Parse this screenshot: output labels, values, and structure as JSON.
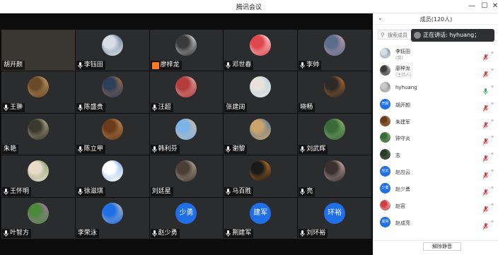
{
  "window": {
    "title": "腾讯会议",
    "min": "—",
    "max": "☐",
    "close": "✕"
  },
  "colors": {
    "host_badge": "#ff7a1a",
    "avatar_blue": "#1e6fe8",
    "mic_muted": "#d23c3c",
    "mic_active": "#32b45a"
  },
  "grid": [
    {
      "name": "胡开颜",
      "avatar": "none",
      "mic": "none",
      "highlight": true
    },
    {
      "name": "李钰田",
      "avatar": "photo",
      "colors": [
        "#4c6a86",
        "#d7dee6"
      ],
      "mic": "icon"
    },
    {
      "name": "廖梓龙",
      "avatar": "photo",
      "colors": [
        "#ffffff",
        "#3a3a3a"
      ],
      "mic": "badge"
    },
    {
      "name": "邓世春",
      "avatar": "photo",
      "colors": [
        "#ffffff",
        "#e0484c"
      ],
      "mic": "icon"
    },
    {
      "name": "李帅",
      "avatar": "photo",
      "colors": [
        "#e6a8b6",
        "#5b6d8a"
      ],
      "mic": "icon"
    },
    {
      "name": "王翀",
      "avatar": "photo",
      "colors": [
        "#d8b070",
        "#6a4a2a"
      ],
      "mic": "icon"
    },
    {
      "name": "陈盛贵",
      "avatar": "photo",
      "colors": [
        "#c47a3c",
        "#2d3f5a"
      ],
      "mic": "icon"
    },
    {
      "name": "汪超",
      "avatar": "photo",
      "colors": [
        "#e8c9c4",
        "#b23b3b"
      ],
      "mic": "icon"
    },
    {
      "name": "张建阔",
      "avatar": "photo",
      "colors": [
        "#a8d0e6",
        "#e8e2da"
      ],
      "mic": "none"
    },
    {
      "name": "晓畅",
      "avatar": "photo",
      "colors": [
        "#e07b2c",
        "#2a2a2a"
      ],
      "mic": "none"
    },
    {
      "name": "朱艳",
      "avatar": "photo",
      "colors": [
        "#d4c7a8",
        "#3b3a2f"
      ],
      "mic": "none"
    },
    {
      "name": "陈立甲",
      "avatar": "photo",
      "colors": [
        "#caa060",
        "#6a3c1c"
      ],
      "mic": "icon"
    },
    {
      "name": "韩利芬",
      "avatar": "photo",
      "colors": [
        "#f0b88a",
        "#7cb4e8"
      ],
      "mic": "icon"
    },
    {
      "name": "谢黎",
      "avatar": "photo",
      "colors": [
        "#3a6fb2",
        "#c9a36a"
      ],
      "mic": "icon"
    },
    {
      "name": "刘武辉",
      "avatar": "photo",
      "colors": [
        "#9ec67a",
        "#3a6a3a"
      ],
      "mic": "icon"
    },
    {
      "name": "王怀明",
      "avatar": "photo",
      "colors": [
        "#6e8e5a",
        "#e8dcc8"
      ],
      "mic": "icon"
    },
    {
      "name": "徐滋琪",
      "avatar": "photo",
      "colors": [
        "#5ea0e0",
        "#ffffff"
      ],
      "mic": "icon"
    },
    {
      "name": "刘廷星",
      "avatar": "photo",
      "colors": [
        "#c9c0b2",
        "#4a3e36"
      ],
      "mic": "none"
    },
    {
      "name": "马百胜",
      "avatar": "photo",
      "colors": [
        "#ee8a22",
        "#1a1a1a"
      ],
      "mic": "icon"
    },
    {
      "name": "亮",
      "avatar": "photo",
      "colors": [
        "#f2d2c8",
        "#3a3030"
      ],
      "mic": "icon"
    },
    {
      "name": "叶智方",
      "avatar": "photo",
      "colors": [
        "#c56fc8",
        "#4a8a3a"
      ],
      "mic": "icon"
    },
    {
      "name": "李荣泳",
      "avatar": "photo",
      "colors": [
        "#d6c8b0",
        "#1e6fe8"
      ],
      "mic": "none"
    },
    {
      "name": "赵少勇",
      "avatar": "text",
      "avatar_text": "少勇",
      "mic": "icon"
    },
    {
      "name": "荆建军",
      "avatar": "text",
      "avatar_text": "建军",
      "mic": "icon"
    },
    {
      "name": "刘环裕",
      "avatar": "text",
      "avatar_text": "环裕",
      "mic": "icon"
    }
  ],
  "sidebar": {
    "collapse_icon": "⌄",
    "member_count": "成员(120人)",
    "search_placeholder": "搜索成员",
    "speaking_tooltip": "正在讲话: hyhuang；",
    "members": [
      {
        "name": "李钰田",
        "role": "(我)",
        "avatar": "photo",
        "colors": [
          "#4c6a86",
          "#d7dee6"
        ],
        "mic": "muted"
      },
      {
        "name": "廖梓龙",
        "role": "(主持人)",
        "avatar": "photo",
        "colors": [
          "#ffffff",
          "#3a3a3a"
        ],
        "mic": "muted"
      },
      {
        "name": "hyhuang",
        "role": "",
        "avatar": "photo",
        "colors": [
          "#6a6a6a",
          "#c8c8c8"
        ],
        "mic": "active"
      },
      {
        "name": "胡开颜",
        "role": "",
        "avatar": "text",
        "avatar_text": "开颜",
        "mic": "muted"
      },
      {
        "name": "朱建军",
        "role": "",
        "avatar": "photo",
        "colors": [
          "#caa060",
          "#6a3c1c"
        ],
        "mic": "muted"
      },
      {
        "name": "钟守炎",
        "role": "",
        "avatar": "photo",
        "colors": [
          "#9ec67a",
          "#3a6a3a"
        ],
        "mic": "muted"
      },
      {
        "name": "志",
        "role": "",
        "avatar": "photo",
        "colors": [
          "#6e8e5a",
          "#2a3a2a"
        ],
        "mic": "muted"
      },
      {
        "name": "赵应云",
        "role": "",
        "avatar": "text",
        "avatar_text": "应云",
        "mic": "muted"
      },
      {
        "name": "赵少勇",
        "role": "",
        "avatar": "text",
        "avatar_text": "少勇",
        "mic": "muted"
      },
      {
        "name": "赵容",
        "role": "",
        "avatar": "photo",
        "colors": [
          "#f4f4f4",
          "#d04040"
        ],
        "mic": "muted"
      },
      {
        "name": "赵成亮",
        "role": "",
        "avatar": "text",
        "avatar_text": "成亮",
        "mic": "muted"
      }
    ],
    "unmute_label": "解除静音"
  }
}
